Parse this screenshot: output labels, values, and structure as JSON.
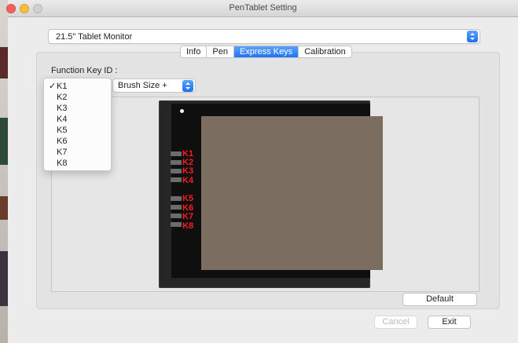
{
  "window": {
    "title": "PenTablet Setting"
  },
  "monitor_select": {
    "value": "21.5\" Tablet Monitor"
  },
  "tabs": [
    {
      "label": "Info",
      "active": false
    },
    {
      "label": "Pen",
      "active": false
    },
    {
      "label": "Express Keys",
      "active": true
    },
    {
      "label": "Calibration",
      "active": false
    }
  ],
  "express_keys": {
    "function_key_label": "Function Key ID :",
    "selected_key": "K1",
    "key_options": [
      "K1",
      "K2",
      "K3",
      "K4",
      "K5",
      "K6",
      "K7",
      "K8"
    ],
    "action_value": "Brush Size +",
    "check_mark": "✓"
  },
  "tablet_keys": [
    "K1",
    "K2",
    "K3",
    "K4",
    "K5",
    "K6",
    "K7",
    "K8"
  ],
  "buttons": {
    "default": "Default",
    "cancel": "Cancel",
    "exit": "Exit"
  },
  "colors": {
    "accent": "#2173f3",
    "key_label": "#ff1c1c",
    "screen": "#7b6e60"
  }
}
